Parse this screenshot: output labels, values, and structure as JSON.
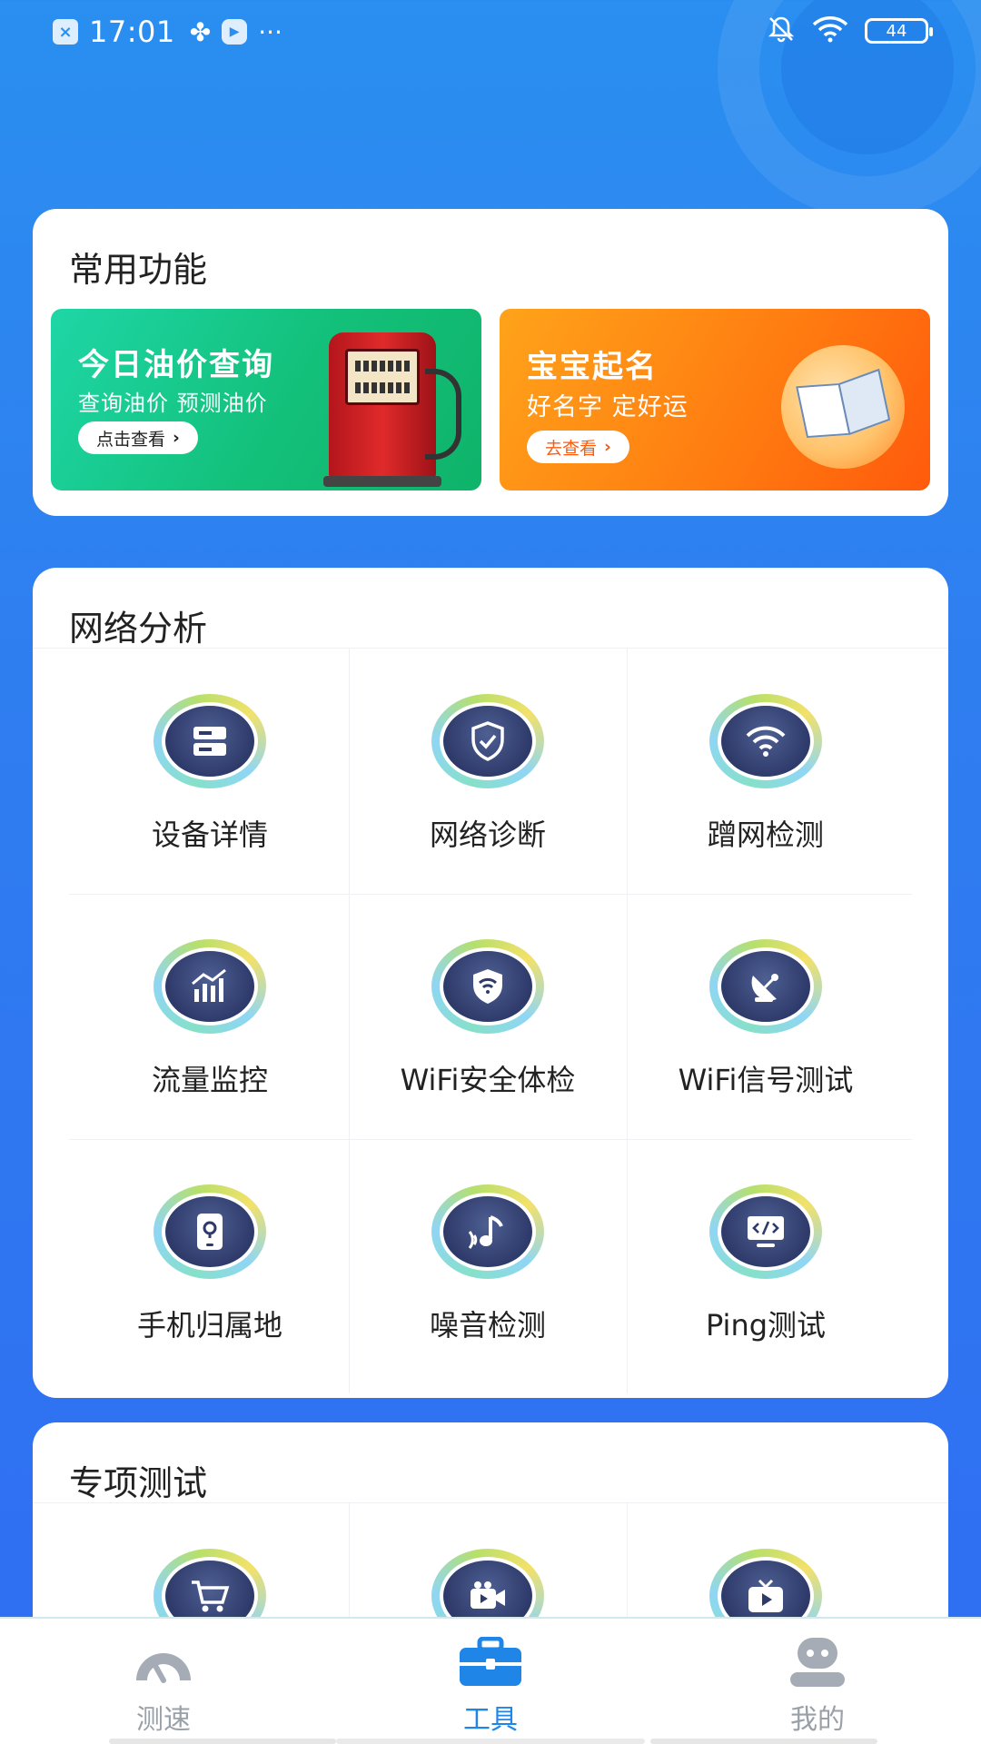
{
  "status_bar": {
    "time": "17:01",
    "more": "···",
    "battery": "44",
    "icons": [
      "close-box-icon",
      "pinwheel-icon",
      "video-icon",
      "mute-bell-icon",
      "wifi-icon",
      "battery-icon"
    ]
  },
  "common": {
    "title": "常用功能",
    "oil_banner": {
      "title": "今日油价查询",
      "subtitle": "查询油价  预测油价",
      "button": "点击查看"
    },
    "baby_banner": {
      "title": "宝宝起名",
      "subtitle": "好名字 定好运",
      "button": "去查看"
    }
  },
  "network": {
    "title": "网络分析",
    "items": [
      {
        "label": "设备详情",
        "icon": "device-list-icon"
      },
      {
        "label": "网络诊断",
        "icon": "shield-check-icon"
      },
      {
        "label": "蹭网检测",
        "icon": "wifi-icon"
      },
      {
        "label": "流量监控",
        "icon": "bar-chart-icon"
      },
      {
        "label": "WiFi安全体检",
        "icon": "wifi-shield-icon"
      },
      {
        "label": "WiFi信号测试",
        "icon": "satellite-dish-icon"
      },
      {
        "label": "手机归属地",
        "icon": "phone-location-icon"
      },
      {
        "label": "噪音检测",
        "icon": "music-note-icon"
      },
      {
        "label": "Ping测试",
        "icon": "code-monitor-icon"
      }
    ]
  },
  "special": {
    "title": "专项测试",
    "items": [
      {
        "icon": "shopping-cart-icon"
      },
      {
        "icon": "video-camera-icon"
      },
      {
        "icon": "tv-play-icon"
      }
    ]
  },
  "bottom_nav": {
    "items": [
      {
        "label": "测速",
        "icon": "speedometer-icon",
        "active": false
      },
      {
        "label": "工具",
        "icon": "toolbox-icon",
        "active": true
      },
      {
        "label": "我的",
        "icon": "profile-robot-icon",
        "active": false
      }
    ]
  },
  "colors": {
    "background": "#2f7ff0",
    "accent": "#1f86e8",
    "oil_banner": "#13c07a",
    "baby_banner": "#ff7a10",
    "icon_inner": "#2e3a6a"
  }
}
